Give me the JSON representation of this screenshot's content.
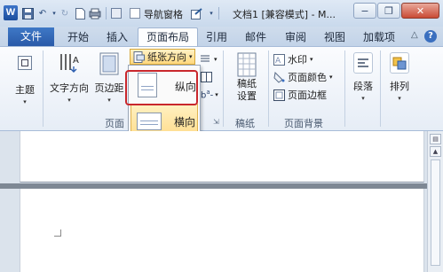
{
  "app": {
    "logo_letter": "W",
    "nav_pane_label": "导航窗格",
    "document_title": "文档1 [兼容模式] - M..."
  },
  "window_controls": {
    "minimize": "−",
    "restore": "❐",
    "close": "✕"
  },
  "tabs": [
    {
      "label": "文件",
      "active": false
    },
    {
      "label": "开始",
      "active": false
    },
    {
      "label": "插入",
      "active": false
    },
    {
      "label": "页面布局",
      "active": true
    },
    {
      "label": "引用",
      "active": false
    },
    {
      "label": "邮件",
      "active": false
    },
    {
      "label": "审阅",
      "active": false
    },
    {
      "label": "视图",
      "active": false
    },
    {
      "label": "加载项",
      "active": false
    }
  ],
  "ribbon": {
    "theme_label": "主题",
    "text_direction_label": "文字方向",
    "margins_label": "页边距",
    "orientation_label": "纸张方向",
    "page_setup_group": "页面",
    "draft_paper_label_line1": "稿纸",
    "draft_paper_label_line2": "设置",
    "draft_paper_group": "稿纸",
    "watermark_label": "水印",
    "page_color_label": "页面颜色",
    "page_border_label": "页面边框",
    "page_background_group": "页面背景",
    "paragraph_label": "段落",
    "arrange_label": "排列"
  },
  "orientation_menu": {
    "portrait": "纵向",
    "landscape": "横向",
    "selected": "landscape"
  },
  "colors": {
    "accent_blue": "#2a5aa8",
    "highlight_red": "#c9272c",
    "hover_yellow": "#ffd87e"
  }
}
